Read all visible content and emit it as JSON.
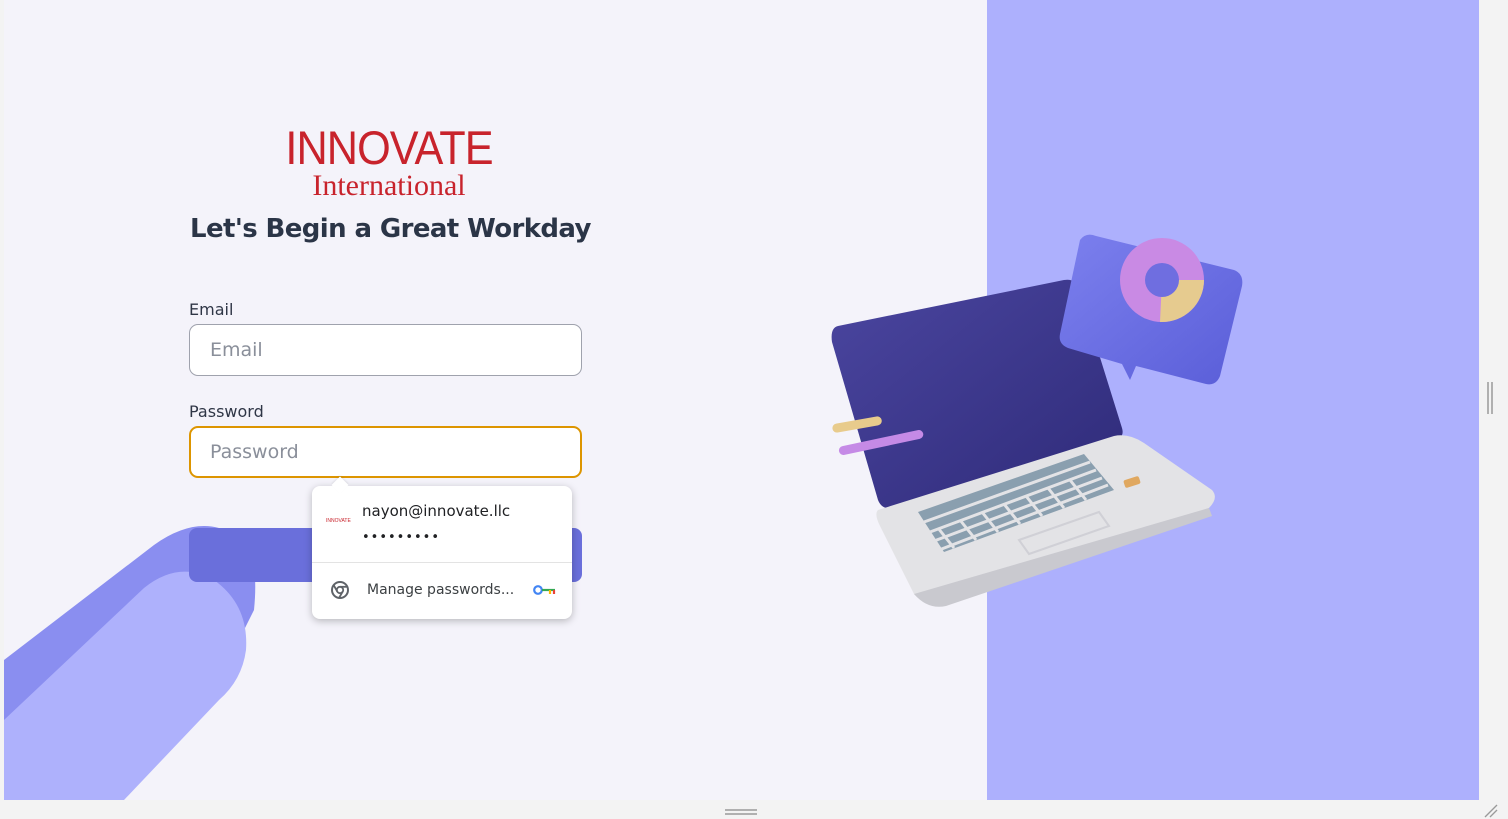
{
  "brand": {
    "logo_line1": "INNOVATE",
    "logo_line2": "International",
    "color": "#c8232c"
  },
  "login": {
    "heading": "Let's Begin a Great Workday",
    "email_label": "Email",
    "email_placeholder": "Email",
    "password_label": "Password",
    "password_placeholder": "Password",
    "submit_color": "#6a6fdb",
    "focus_color": "#dd9500"
  },
  "autofill": {
    "email": "nayon@innovate.llc",
    "password_mask": "•••••••••",
    "manage_label": "Manage passwords...",
    "site_icon_text": "INNOVATE",
    "icons": [
      "chrome-icon",
      "key-icon"
    ]
  },
  "illustration": {
    "panel_color": "#adb0fd",
    "items": [
      "laptop",
      "donut-chart-card",
      "hand-arm"
    ]
  }
}
